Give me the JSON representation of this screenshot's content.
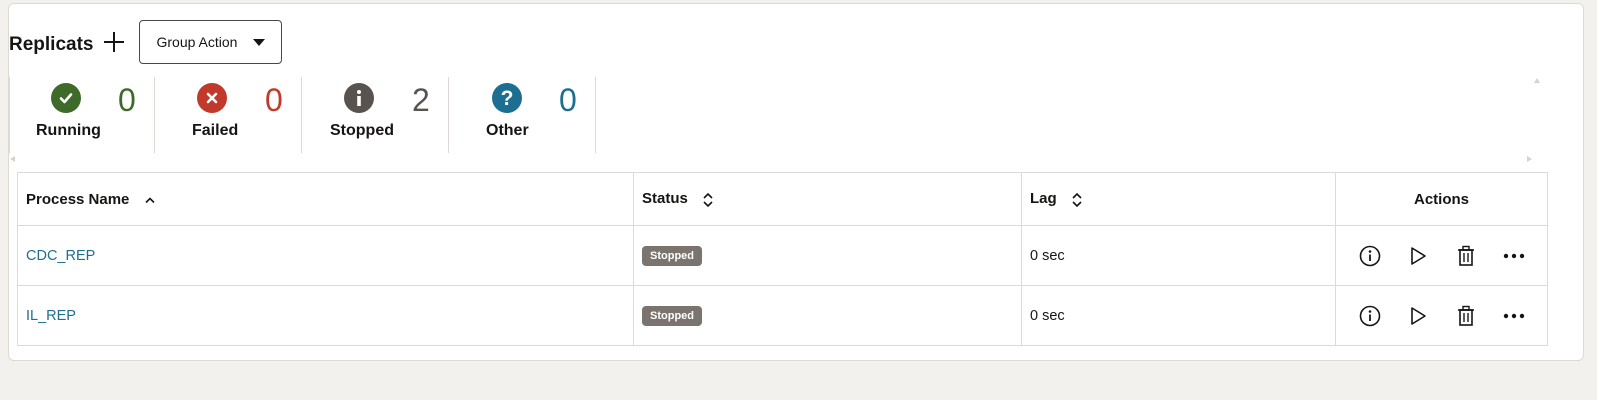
{
  "header": {
    "title": "Replicats",
    "group_action_label": "Group Action"
  },
  "summary": [
    {
      "name": "running",
      "label": "Running",
      "count": "0",
      "color": "#3e6b2a",
      "icon": "check-circle-icon"
    },
    {
      "name": "failed",
      "label": "Failed",
      "count": "0",
      "color": "#c0392b",
      "icon": "x-circle-icon"
    },
    {
      "name": "stopped",
      "label": "Stopped",
      "count": "2",
      "color": "#58534f",
      "icon": "info-circle-icon"
    },
    {
      "name": "other",
      "label": "Other",
      "count": "0",
      "color": "#1d6f91",
      "icon": "question-circle-icon"
    }
  ],
  "table": {
    "columns": [
      "Process Name",
      "Status",
      "Lag",
      "Actions"
    ],
    "rows": [
      {
        "name": "CDC_REP",
        "status": "Stopped",
        "lag": "0 sec"
      },
      {
        "name": "IL_REP",
        "status": "Stopped",
        "lag": "0 sec"
      }
    ]
  },
  "colors": {
    "link": "#1f6f8b",
    "badge": "#7a736e"
  }
}
